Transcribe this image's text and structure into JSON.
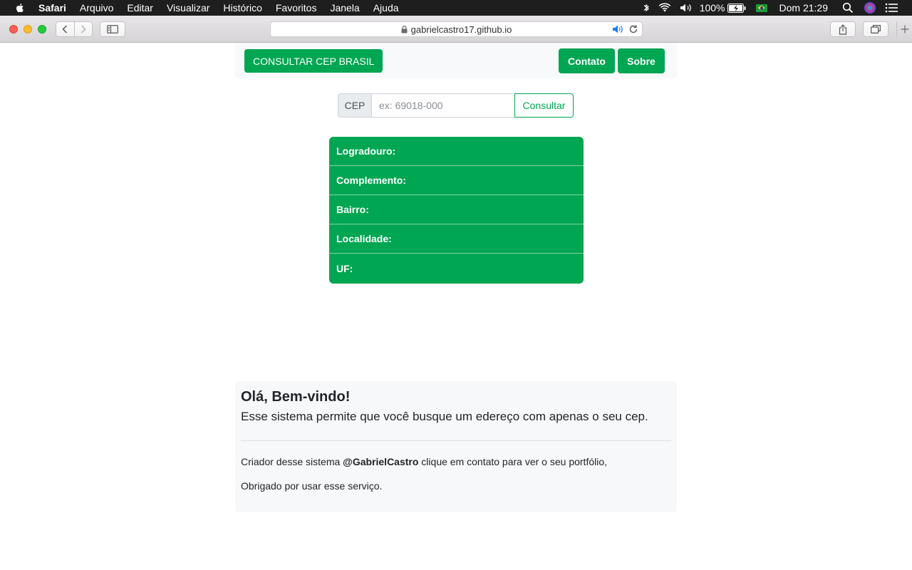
{
  "menubar": {
    "app": "Safari",
    "items": [
      "Arquivo",
      "Editar",
      "Visualizar",
      "Histórico",
      "Favoritos",
      "Janela",
      "Ajuda"
    ],
    "battery": "100%",
    "clock": "Dom 21:29"
  },
  "browser": {
    "url": "gabrielcastro17.github.io"
  },
  "navbar": {
    "brand": "CONSULTAR CEP BRASIL",
    "contato": "Contato",
    "sobre": "Sobre"
  },
  "search": {
    "label": "CEP",
    "placeholder": "ex: 69018-000",
    "button": "Consultar"
  },
  "results": [
    {
      "label": "Logradouro:"
    },
    {
      "label": "Complemento:"
    },
    {
      "label": "Bairro:"
    },
    {
      "label": "Localidade:"
    },
    {
      "label": "UF:"
    }
  ],
  "welcome": {
    "title": "Olá, Bem-vindo!",
    "lead": "Esse sistema permite que você busque um edereço com apenas o seu cep.",
    "creator_prefix": "Criador desse sistema ",
    "creator_handle": "@GabrielCastro",
    "creator_suffix": " clique em contato para ver o seu portfólio,",
    "thanks": "Obrigado por usar esse serviço."
  },
  "colors": {
    "accent": "#00a651",
    "panel": "#f8f9fa"
  }
}
